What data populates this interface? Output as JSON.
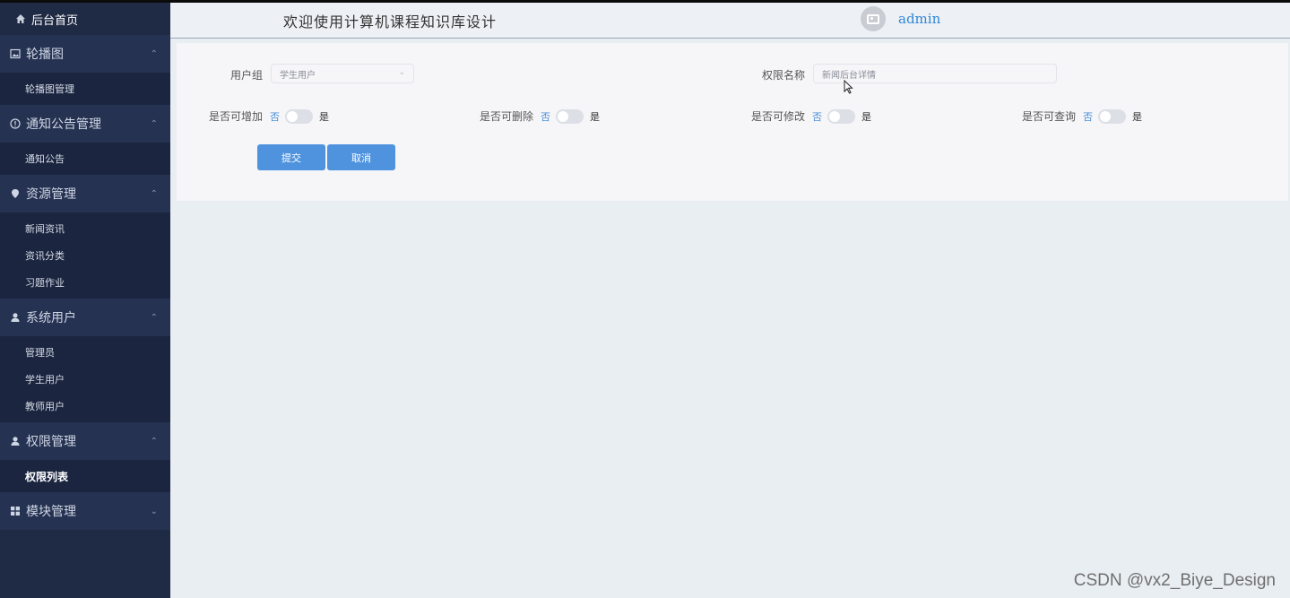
{
  "sidebar": {
    "home_label": "后台首页",
    "groups": [
      {
        "label": "轮播图",
        "icon": "image-icon",
        "items": [
          {
            "label": "轮播图管理"
          }
        ]
      },
      {
        "label": "通知公告管理",
        "icon": "info-circle-icon",
        "items": [
          {
            "label": "通知公告"
          }
        ]
      },
      {
        "label": "资源管理",
        "icon": "location-pin-icon",
        "items": [
          {
            "label": "新闻资讯"
          },
          {
            "label": "资讯分类"
          },
          {
            "label": "习题作业"
          }
        ]
      },
      {
        "label": "系统用户",
        "icon": "user-icon",
        "items": [
          {
            "label": "管理员"
          },
          {
            "label": "学生用户"
          },
          {
            "label": "教师用户"
          }
        ]
      },
      {
        "label": "权限管理",
        "icon": "user-icon",
        "items": [
          {
            "label": "权限列表"
          }
        ]
      },
      {
        "label": "模块管理",
        "icon": "grid-icon",
        "items": []
      }
    ]
  },
  "header": {
    "title": "欢迎使用计算机课程知识库设计",
    "username": "admin"
  },
  "form": {
    "user_group_label": "用户组",
    "user_group_value": "学生用户",
    "permission_name_label": "权限名称",
    "permission_name_value": "新闻后台详情",
    "toggles": [
      {
        "label": "是否可增加",
        "off": "否",
        "on": "是",
        "value": false
      },
      {
        "label": "是否可删除",
        "off": "否",
        "on": "是",
        "value": false
      },
      {
        "label": "是否可修改",
        "off": "否",
        "on": "是",
        "value": false
      },
      {
        "label": "是否可查询",
        "off": "否",
        "on": "是",
        "value": false
      }
    ],
    "submit_label": "提交",
    "cancel_label": "取消"
  },
  "watermark": "CSDN @vx2_Biye_Design",
  "colors": {
    "sidebar_bg": "#1f2a44",
    "accent": "#4f93de",
    "username": "#2f86d6"
  }
}
